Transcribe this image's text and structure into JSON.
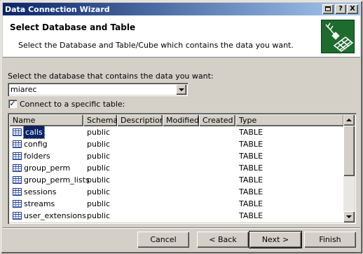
{
  "window": {
    "title": "Data Connection Wizard",
    "title_buttons": [
      "?",
      "?",
      "X"
    ]
  },
  "header": {
    "title": "Select Database and Table",
    "subtitle": "Select the Database and Table/Cube which contains the data you want.",
    "icon": "wizard-table-plug-icon"
  },
  "database": {
    "label": "Select the database that contains the data you want:",
    "value": "miarec"
  },
  "connect_specific": {
    "label": "Connect to a specific table:",
    "checked": true
  },
  "table_list": {
    "columns": [
      "Name",
      "Schema",
      "Description",
      "Modified",
      "Created",
      "Type"
    ],
    "rows": [
      {
        "name": "calls",
        "schema": "public",
        "description": "",
        "modified": "",
        "created": "",
        "type": "TABLE",
        "selected": true
      },
      {
        "name": "config",
        "schema": "public",
        "description": "",
        "modified": "",
        "created": "",
        "type": "TABLE"
      },
      {
        "name": "folders",
        "schema": "public",
        "description": "",
        "modified": "",
        "created": "",
        "type": "TABLE"
      },
      {
        "name": "group_perm",
        "schema": "public",
        "description": "",
        "modified": "",
        "created": "",
        "type": "TABLE"
      },
      {
        "name": "group_perm_lists",
        "schema": "public",
        "description": "",
        "modified": "",
        "created": "",
        "type": "TABLE"
      },
      {
        "name": "sessions",
        "schema": "public",
        "description": "",
        "modified": "",
        "created": "",
        "type": "TABLE"
      },
      {
        "name": "streams",
        "schema": "public",
        "description": "",
        "modified": "",
        "created": "",
        "type": "TABLE"
      },
      {
        "name": "user_extensions",
        "schema": "public",
        "description": "",
        "modified": "",
        "created": "",
        "type": "TABLE"
      }
    ]
  },
  "buttons": {
    "cancel": "Cancel",
    "back": "< Back",
    "next": "Next >",
    "finish": "Finish"
  },
  "colors": {
    "titlebar_start": "#0a246a",
    "titlebar_end": "#a6caf0",
    "face": "#d4d0c8",
    "selection": "#0a246a",
    "icon_green": "#1e6b2e"
  }
}
